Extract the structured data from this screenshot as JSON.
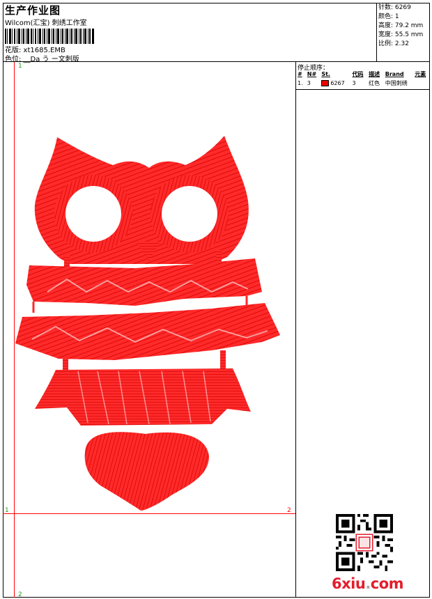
{
  "header": {
    "title": "生产作业图",
    "subtitle": "Wilcom(汇宝) 刺绣工作室",
    "design_file": "花版: xt1685.EMB",
    "color_position": "色位: __Da う ー文刺版"
  },
  "stats": {
    "stitches": "针数: 6269",
    "colors": "颜色: 1",
    "height": "高度: 79.2 mm",
    "width": "宽度: 55.5 mm",
    "ratio": "比例: 2.32"
  },
  "stop_sequence": {
    "title": "停止顺序：",
    "columns": [
      "#",
      "N#",
      "St.",
      "代码",
      "描述",
      "Brand",
      "元素"
    ],
    "rows": [
      {
        "index": "1.",
        "needle": "3",
        "swatch_color": "#e60000",
        "stitches": "6267",
        "code": "3",
        "description": "红色",
        "brand": "中国刺绣",
        "element": ""
      }
    ]
  },
  "guides": {
    "v_top": "1",
    "v_bottom": "2",
    "h_left": "1",
    "h_right": "2"
  },
  "colors": {
    "thread": "#ff0000",
    "guide": "#ff0000",
    "guide_green": "#1a9d1a"
  },
  "watermark": {
    "brand": "6xiu",
    "dot": ".",
    "tld": "com"
  }
}
